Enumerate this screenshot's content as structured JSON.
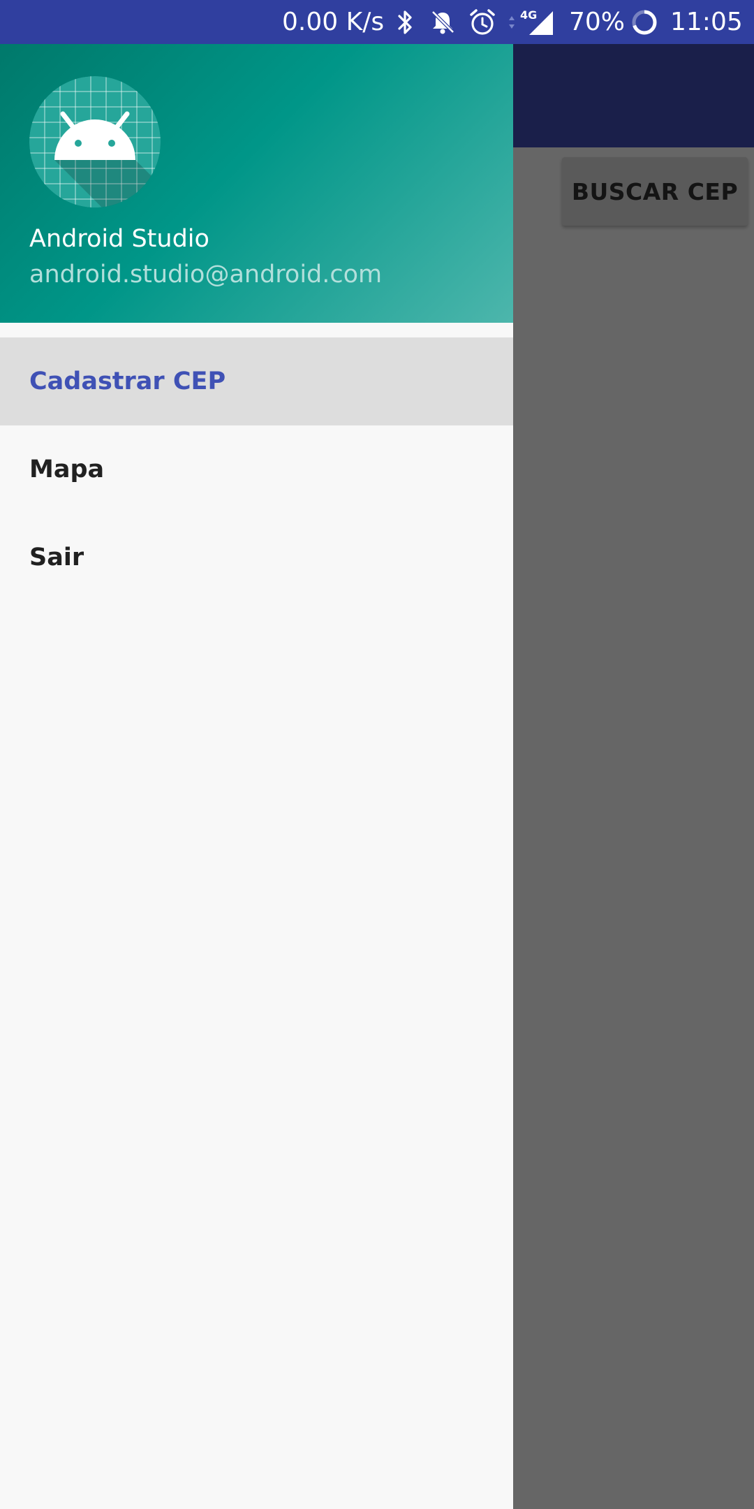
{
  "status_bar": {
    "net_speed": "0.00 K/s",
    "network_type": "4G",
    "battery": "70%",
    "time": "11:05",
    "icons": [
      "bluetooth-icon",
      "notifications-off-icon",
      "alarm-icon",
      "data-arrows-icon",
      "signal-icon",
      "battery-ring-icon"
    ]
  },
  "drawer": {
    "header": {
      "name": "Android Studio",
      "email": "android.studio@android.com",
      "avatar_icon": "android-logo-icon"
    },
    "menu": [
      {
        "label": "Cadastrar CEP",
        "selected": true
      },
      {
        "label": "Mapa",
        "selected": false
      },
      {
        "label": "Sair",
        "selected": false
      }
    ]
  },
  "main": {
    "buscar_button": "BUSCAR CEP"
  },
  "colors": {
    "status_bar": "#303F9F",
    "header_start": "#00796B",
    "header_end": "#4DB6AC",
    "selected_text": "#3F51B5",
    "selected_bg": "#DDDDDD",
    "scrim": "#666666"
  }
}
